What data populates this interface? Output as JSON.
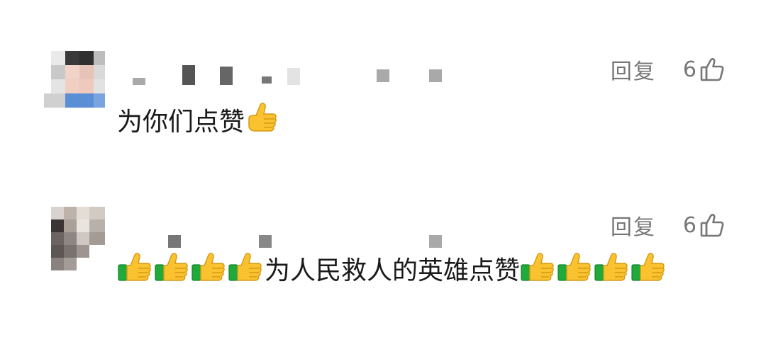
{
  "comments": [
    {
      "reply_label": "回复",
      "like_count": "6",
      "text": "为你们点赞",
      "trailing_emoji": "thumbs-up-icon"
    },
    {
      "reply_label": "回复",
      "like_count": "6",
      "text": "为人民救人的英雄点赞",
      "leading_emoji_count": 4,
      "trailing_emoji_count": 4,
      "emoji": "thumbs-up-cuff-icon"
    }
  ],
  "colors": {
    "action_gray": "#777777",
    "text": "#1a1a1a",
    "placeholder_gray": "#a9a9a9",
    "thumb_yellow": "#f9c22e",
    "cuff_green": "#1faa3a"
  }
}
